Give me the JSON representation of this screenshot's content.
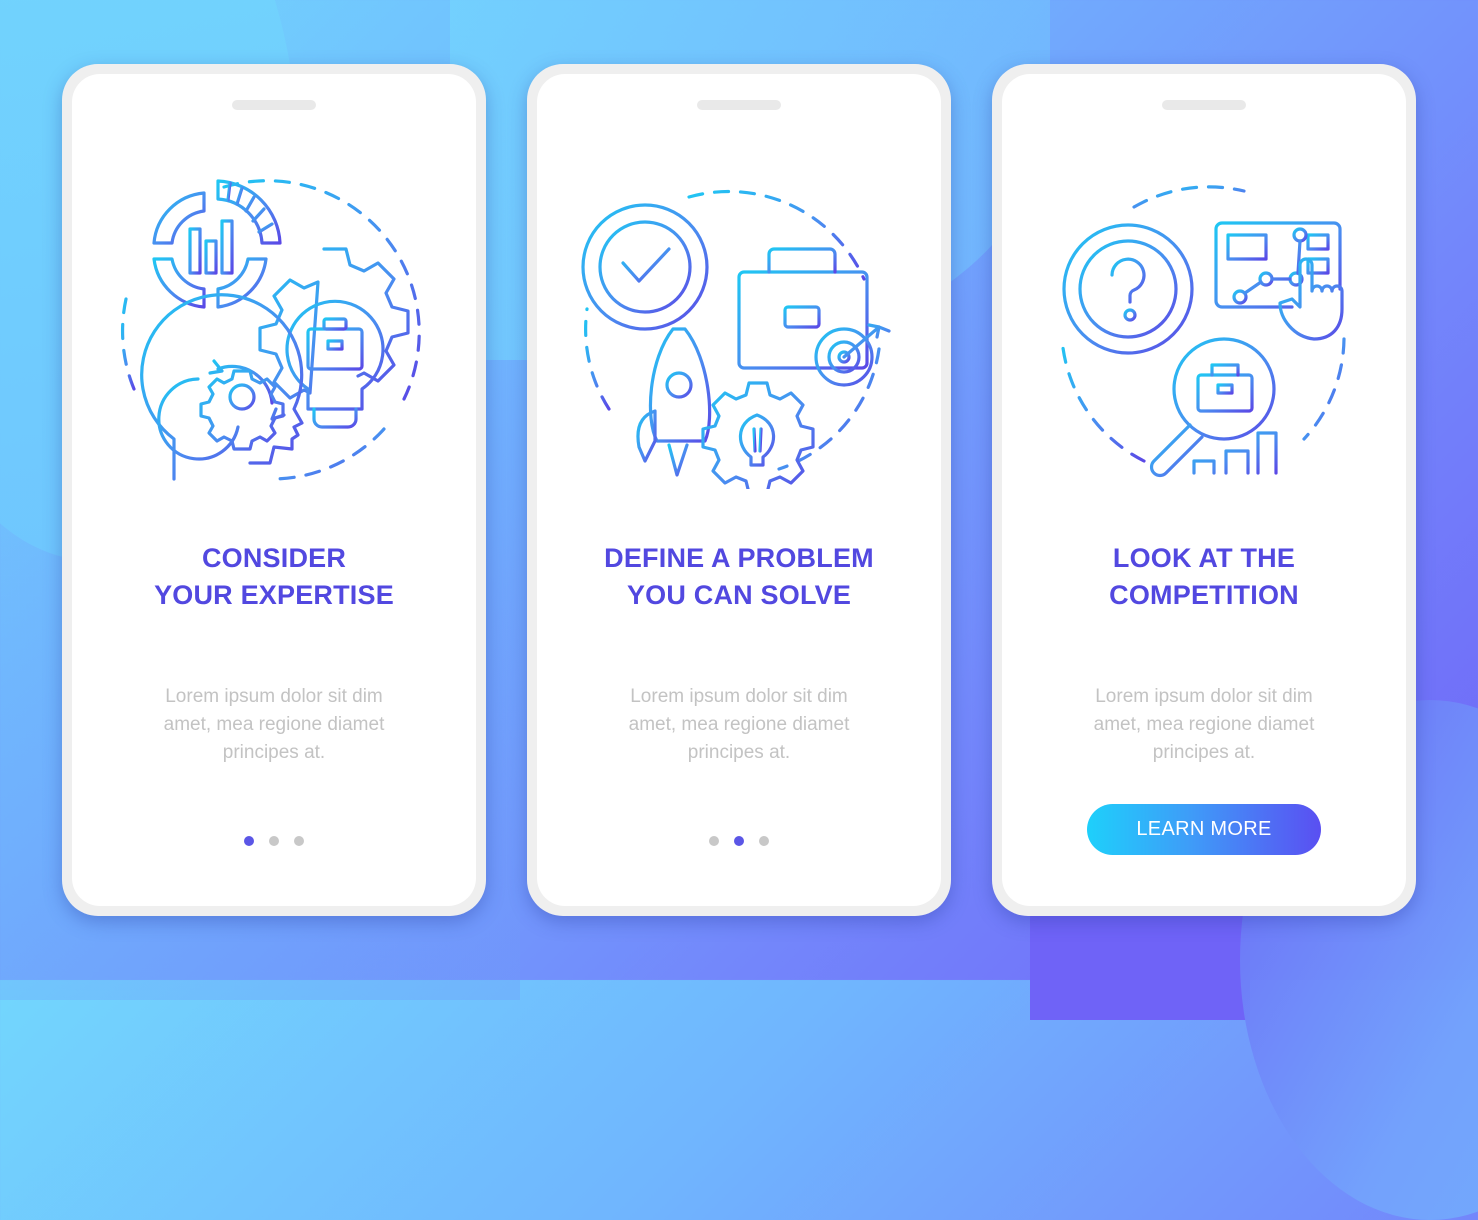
{
  "colors": {
    "title": "#5248e0",
    "body_text": "#c3c3c3",
    "dot_active": "#5b56e6",
    "dot_inactive": "#c8c8c8",
    "gradient_start": "#1ed0fb",
    "gradient_end": "#5a4ff2"
  },
  "screens": [
    {
      "illustration": "expertise-illustration",
      "icons": [
        "pie-chart-icon",
        "gear-lightbulb-briefcase-icon",
        "head-gear-icon"
      ],
      "title_lines": [
        "CONSIDER",
        "YOUR EXPERTISE"
      ],
      "body_lines": [
        "Lorem ipsum dolor sit dim",
        "amet, mea regione diamet",
        "principes at."
      ],
      "pagination": {
        "current": 1,
        "total": 3
      }
    },
    {
      "illustration": "problem-illustration",
      "icons": [
        "target-check-icon",
        "briefcase-icon",
        "bullseye-icon",
        "rocket-icon",
        "gear-lightbulb-icon"
      ],
      "title_lines": [
        "DEFINE A PROBLEM",
        "YOU CAN SOLVE"
      ],
      "body_lines": [
        "Lorem ipsum dolor sit dim",
        "amet, mea regione diamet",
        "principes at."
      ],
      "pagination": {
        "current": 2,
        "total": 3
      }
    },
    {
      "illustration": "competition-illustration",
      "icons": [
        "target-question-icon",
        "dashboard-touch-icon",
        "magnifier-briefcase-icon",
        "bar-chart-icon"
      ],
      "title_lines": [
        "LOOK AT THE",
        "COMPETITION"
      ],
      "body_lines": [
        "Lorem ipsum dolor sit dim",
        "amet, mea regione diamet",
        "principes at."
      ],
      "button_label": "LEARN MORE"
    }
  ]
}
